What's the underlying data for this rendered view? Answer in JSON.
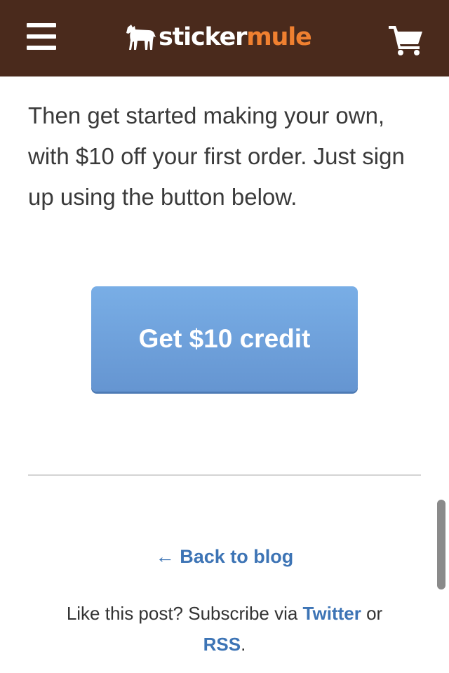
{
  "header": {
    "background_color": "#4a2a1c",
    "menu_icon": "hamburger-menu-icon",
    "logo": {
      "part_sticker": "sticker",
      "part_mule": "mule",
      "sticker_color": "#ffffff",
      "mule_color": "#f08030",
      "icon": "mule-logo-icon"
    },
    "cart_icon": "shopping-cart-icon"
  },
  "content": {
    "intro_text": "Then get started making your own, with $10 off your first order. Just sign up using the button below.",
    "cta_button": {
      "label": "Get $10 credit",
      "color": "#6fa3de"
    }
  },
  "footer": {
    "back_link": "← Back to blog",
    "subscribe": {
      "prefix": "Like this post? Subscribe via ",
      "twitter_label": "Twitter",
      "middle": " or ",
      "rss_label": "RSS",
      "suffix": "."
    },
    "link_color": "#3d74b5"
  }
}
